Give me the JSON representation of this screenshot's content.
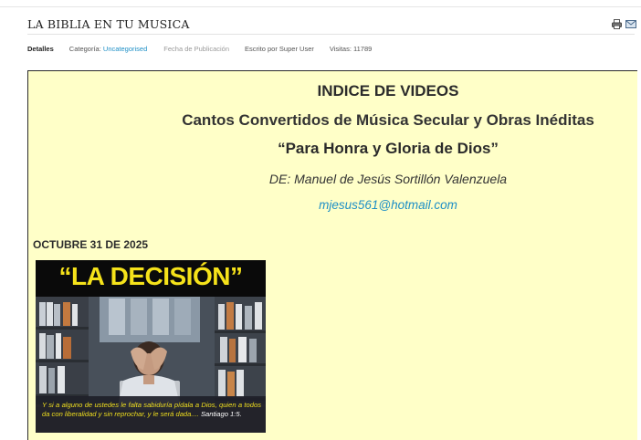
{
  "article": {
    "title": "LA BIBLIA EN TU MUSICA",
    "icons": [
      "print-icon",
      "email-icon"
    ]
  },
  "meta": {
    "details_label": "Detalles",
    "category_label": "Categoría:",
    "category_value": "Uncategorised",
    "published_label": "Fecha de Publicación",
    "author_text": "Escrito por Super User",
    "visits_text": "Visitas: 11789"
  },
  "content": {
    "heading": "INDICE DE VIDEOS",
    "subtitle": "Cantos Convertidos de Música Secular y Obras Inéditas",
    "tagline": "“Para Honra y Gloria de Dios”",
    "author_line": "DE: Manuel de Jesús Sortillón Valenzuela",
    "email": "mjesus561@hotmail.com",
    "date_label": "OCTUBRE 31 DE 2025",
    "video": {
      "title": "“LA DECISIÓN”",
      "verse": "Y si a alguno de ustedes le falta sabiduría pídala a Dios, quien a todos da con liberalidad y sin reprochar, y le será dada....",
      "verse_ref": "Santiago 1:5."
    }
  },
  "colors": {
    "content_bg": "#ffffc8",
    "link": "#1e8fc6",
    "thumb_title": "#f5e21a"
  }
}
